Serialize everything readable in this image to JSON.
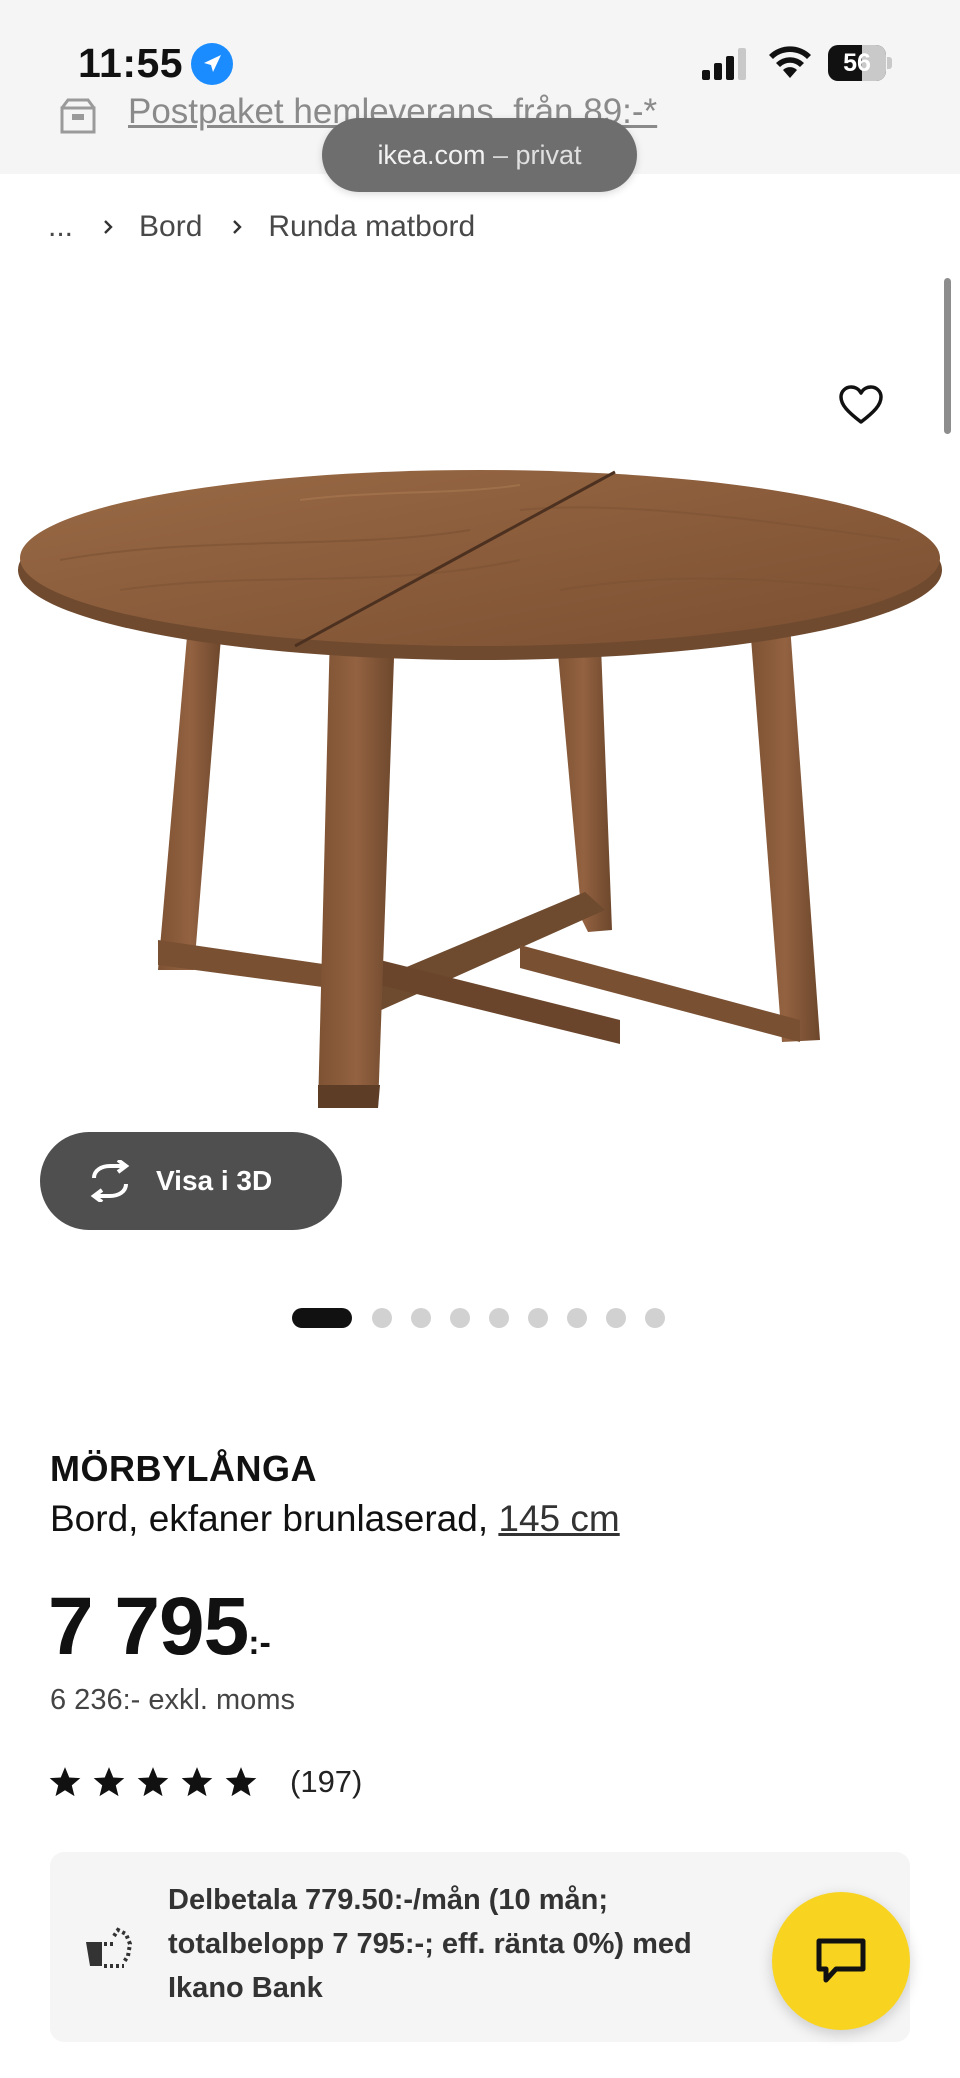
{
  "status_bar": {
    "time": "11:55",
    "battery": "56",
    "icons": [
      "location-arrow-icon",
      "cellular-signal-icon",
      "wifi-icon",
      "battery-icon"
    ]
  },
  "banner": {
    "icon": "delivery-box-icon",
    "text": "Postpaket hemleverans, från 89:-*"
  },
  "browser": {
    "domain": "ikea.com",
    "separator": " – ",
    "mode": "privat"
  },
  "breadcrumb": [
    "...",
    "Bord",
    "Runda matbord"
  ],
  "gallery": {
    "view_3d_label": "Visa i 3D",
    "active_index": 0,
    "dot_count": 9
  },
  "product": {
    "name": "MÖRBYLÅNGA",
    "description": "Bord, ekfaner brunlaserad,",
    "size": "145 cm",
    "price": "7 795",
    "price_suffix": ":-",
    "price_ex_vat": "6 236:- exkl. moms",
    "rating_stars": 5,
    "rating_count": "(197)"
  },
  "financing": {
    "text": "Delbetala 779.50:-/mån (10 mån; totalbelopp 7 795:-; eff. ränta 0%) med Ikano Bank"
  },
  "colors": {
    "chat_button": "#f8d420",
    "view3d_button": "#4f4f4f",
    "wood": "#8b5e3c"
  }
}
